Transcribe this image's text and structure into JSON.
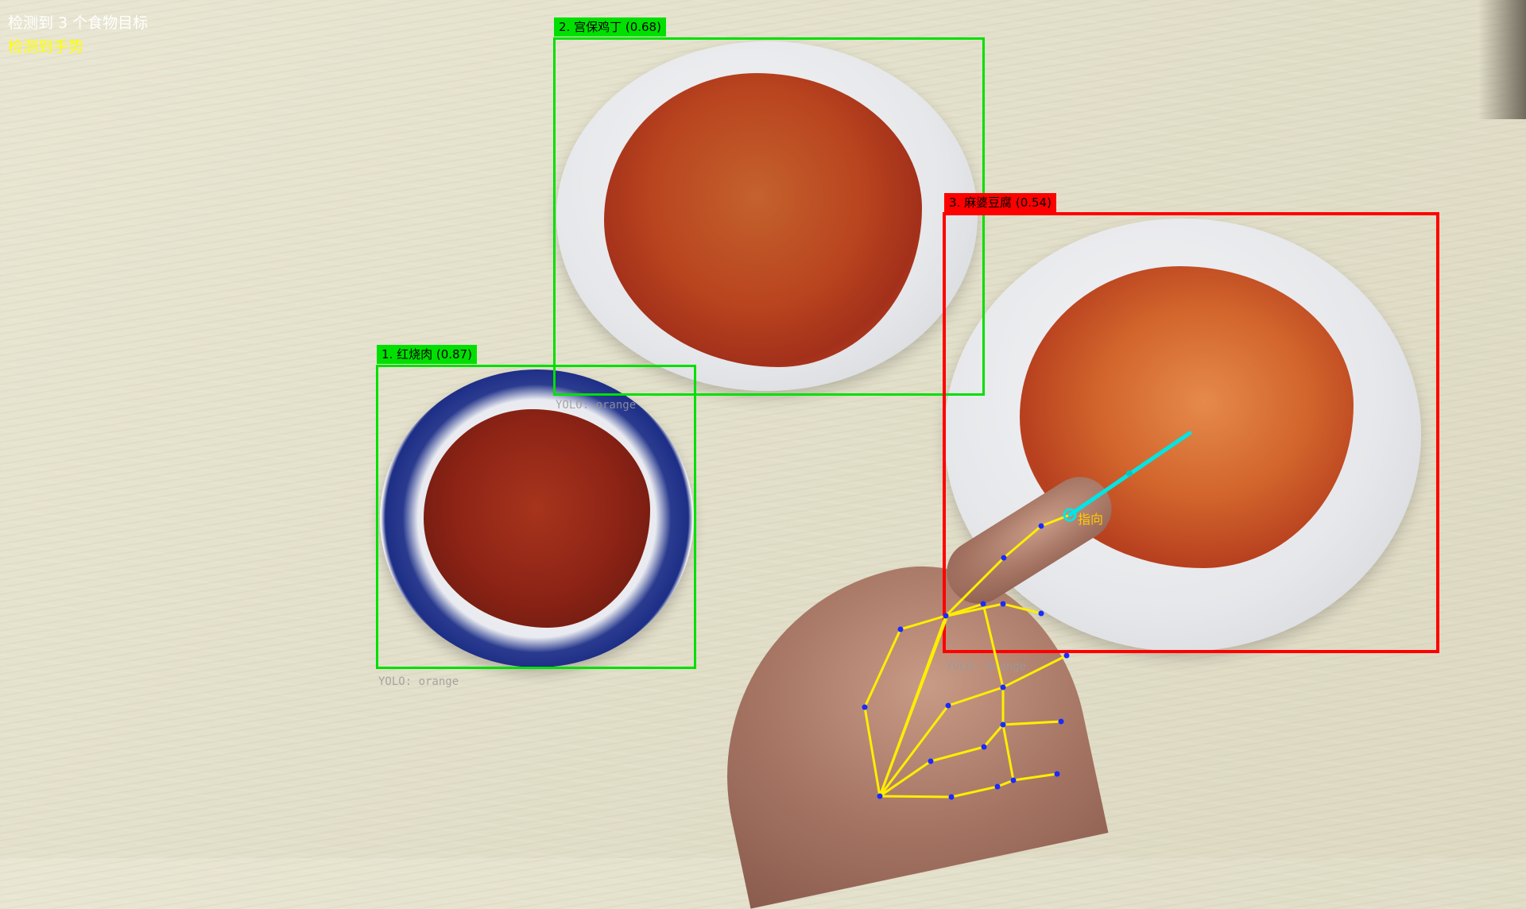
{
  "hud": {
    "count_text": "检测到 3 个食物目标",
    "gesture_text": "检测到手势"
  },
  "detections": [
    {
      "id": 1,
      "label": "1. 红烧肉 (0.87)",
      "source": "YOLO: orange"
    },
    {
      "id": 2,
      "label": "2. 宫保鸡丁 (0.68)",
      "source": "YOLO: orange"
    },
    {
      "id": 3,
      "label": "3. 麻婆豆腐 (0.54)",
      "source": "YOLO: orange"
    }
  ],
  "gesture": {
    "label": "指向"
  },
  "colors": {
    "box_normal": "#00e000",
    "box_selected": "#ff0000",
    "hud_white": "#ffffff",
    "hud_yellow": "#ffff00",
    "skeleton": "#ffee00",
    "joint": "#1a2bff",
    "pointer_ray": "#00e5e5"
  }
}
